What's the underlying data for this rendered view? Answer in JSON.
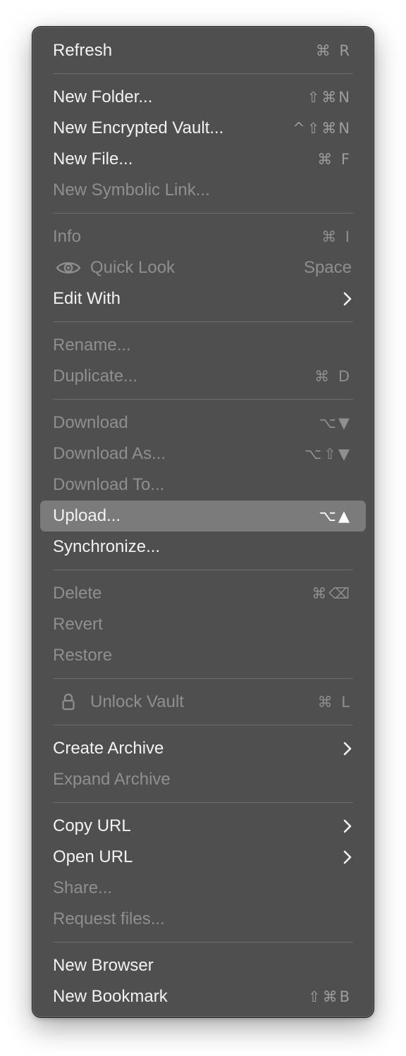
{
  "menu": {
    "refresh": {
      "label": "Refresh",
      "shortcut": "⌘ R"
    },
    "new_folder": {
      "label": "New Folder...",
      "shortcut": "⇧⌘N"
    },
    "new_vault": {
      "label": "New Encrypted Vault...",
      "shortcut": "^⇧⌘N"
    },
    "new_file": {
      "label": "New File...",
      "shortcut": "⌘ F"
    },
    "new_symlink": {
      "label": "New Symbolic Link..."
    },
    "info": {
      "label": "Info",
      "shortcut": "⌘  I"
    },
    "quick_look": {
      "label": "Quick Look",
      "shortcut": "Space",
      "icon": "eye-icon"
    },
    "edit_with": {
      "label": "Edit With",
      "icon": "chevron-right-icon"
    },
    "rename": {
      "label": "Rename..."
    },
    "duplicate": {
      "label": "Duplicate...",
      "shortcut": "⌘ D"
    },
    "download": {
      "label": "Download",
      "shortcut": "⌥▼"
    },
    "download_as": {
      "label": "Download As...",
      "shortcut": "⌥⇧▼"
    },
    "download_to": {
      "label": "Download To..."
    },
    "upload": {
      "label": "Upload...",
      "shortcut": "⌥▲"
    },
    "synchronize": {
      "label": "Synchronize..."
    },
    "delete": {
      "label": "Delete",
      "shortcut": "⌘⌫"
    },
    "revert": {
      "label": "Revert"
    },
    "restore": {
      "label": "Restore"
    },
    "unlock_vault": {
      "label": "Unlock Vault",
      "shortcut": "⌘ L",
      "icon": "lock-icon"
    },
    "create_archive": {
      "label": "Create Archive",
      "icon": "chevron-right-icon"
    },
    "expand_archive": {
      "label": "Expand Archive"
    },
    "copy_url": {
      "label": "Copy URL",
      "icon": "chevron-right-icon"
    },
    "open_url": {
      "label": "Open URL",
      "icon": "chevron-right-icon"
    },
    "share": {
      "label": "Share..."
    },
    "request_files": {
      "label": "Request files..."
    },
    "new_browser": {
      "label": "New Browser"
    },
    "new_bookmark": {
      "label": "New Bookmark",
      "shortcut": "⇧⌘B"
    }
  },
  "colors": {
    "menu_background": "#4f4f4f",
    "highlight": "#7b7b7b",
    "enabled_text": "#f2f2f2",
    "disabled_text": "#8f8f8f"
  }
}
